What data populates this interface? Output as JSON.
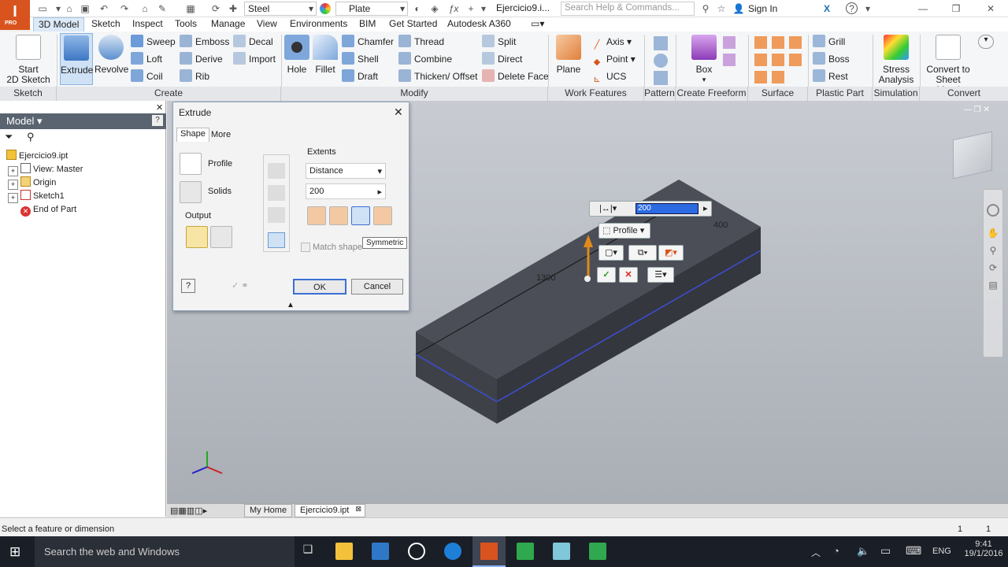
{
  "app": {
    "logo_letter": "I",
    "edition": "PRO",
    "material": "Steel",
    "appearance": "Plate",
    "doc_tab": "Ejercicio9.i...",
    "search_placeholder": "Search Help & Commands...",
    "sign_in": "Sign In"
  },
  "ribbon_tabs": [
    "3D Model",
    "Sketch",
    "Inspect",
    "Tools",
    "Manage",
    "View",
    "Environments",
    "BIM",
    "Get Started",
    "Autodesk A360"
  ],
  "ribbon": {
    "start_sketch": "Start\n2D Sketch",
    "extrude": "Extrude",
    "revolve": "Revolve",
    "create_small": [
      "Sweep",
      "Loft",
      "Coil",
      "Emboss",
      "Derive",
      "Rib",
      "Decal",
      "Import"
    ],
    "hole": "Hole",
    "fillet": "Fillet",
    "modify_small": [
      "Chamfer",
      "Shell",
      "Draft",
      "Thread",
      "Combine",
      "Thicken/ Offset",
      "Split",
      "Direct",
      "Delete Face"
    ],
    "plane": "Plane",
    "work_small": [
      "Axis",
      "Point",
      "UCS"
    ],
    "box": "Box",
    "plastic_small": [
      "Grill",
      "Boss",
      "Rest"
    ],
    "stress": "Stress\nAnalysis",
    "convert": "Convert to\nSheet Metal",
    "panels": [
      "Sketch",
      "Create",
      "Modify",
      "Work Features",
      "Pattern",
      "Create Freeform",
      "Surface",
      "Plastic Part",
      "Simulation",
      "Convert"
    ]
  },
  "browser": {
    "title": "Model",
    "items": [
      "Ejercicio9.ipt",
      "View: Master",
      "Origin",
      "Sketch1",
      "End of Part"
    ]
  },
  "dialog": {
    "title": "Extrude",
    "tabs": [
      "Shape",
      "More"
    ],
    "profile": "Profile",
    "solids": "Solids",
    "output": "Output",
    "extents": "Extents",
    "method": "Distance",
    "distance": "200",
    "match_shape": "Match shape",
    "tooltip": "Symmetric",
    "ok": "OK",
    "cancel": "Cancel"
  },
  "minitoolbar": {
    "value": "200",
    "profile": "Profile"
  },
  "dims": {
    "length": "1300",
    "width": "400"
  },
  "bottom_tabs": [
    "My Home",
    "Ejercicio9.ipt"
  ],
  "status": {
    "text": "Select a feature or dimension",
    "n1": "1",
    "n2": "1"
  },
  "taskbar": {
    "search": "Search the web and Windows",
    "lang": "ENG",
    "time": "9:41",
    "date": "19/1/2016"
  },
  "colors": {
    "accent": "#d9531e",
    "selection": "#3b6fd4",
    "body": "#4a4d54"
  }
}
